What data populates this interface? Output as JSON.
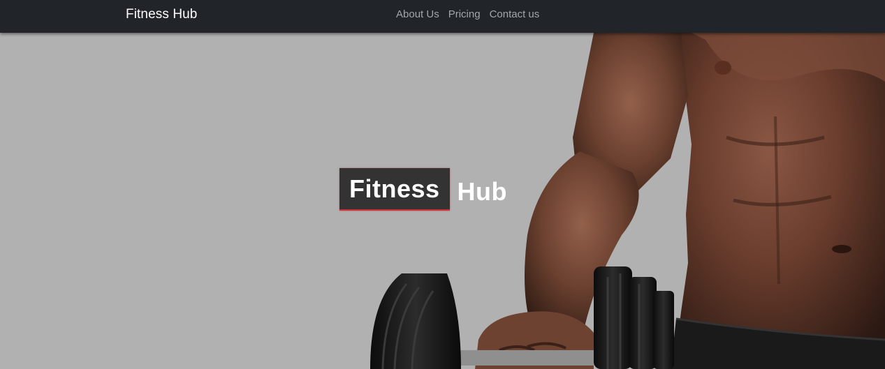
{
  "navbar": {
    "brand": "Fitness Hub",
    "links": [
      {
        "label": "About Us"
      },
      {
        "label": "Pricing"
      },
      {
        "label": "Contact us"
      }
    ]
  },
  "hero": {
    "title_highlight": "Fitness",
    "title_rest": "Hub",
    "image": "man-holding-dumbbell-photo"
  },
  "colors": {
    "navbar_bg": "#212529",
    "hero_bg": "#b1b1b1",
    "title_box_bg": "#333333",
    "title_accent": "#c8313a"
  }
}
